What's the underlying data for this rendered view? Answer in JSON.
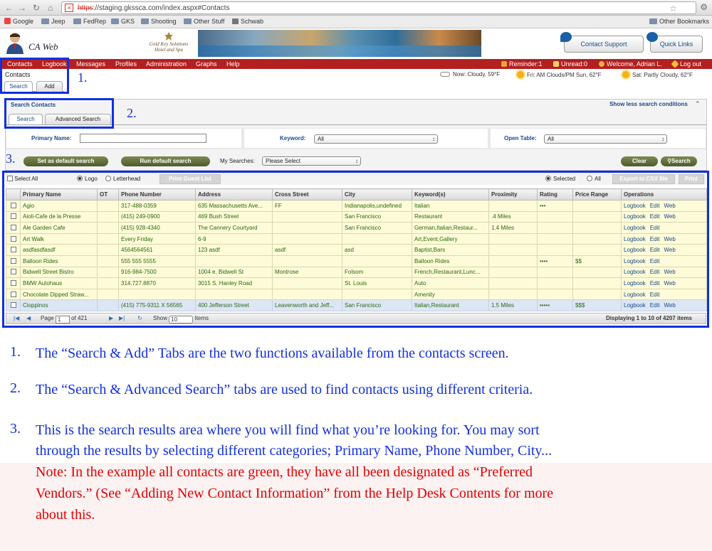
{
  "browser": {
    "url_scheme": "https",
    "url_rest": "://staging.gkssca.com/index.aspx#Contacts",
    "bookmarks": [
      "Google",
      "Jeep",
      "FedRep",
      "GKS",
      "Shooting",
      "Other Stuff",
      "Schwab"
    ],
    "other_bookmarks": "Other Bookmarks"
  },
  "header": {
    "app_name": "CA Web",
    "hotel_logo": "Gold Key Solutions Hotel and Spa",
    "contact_support": "Contact Support",
    "quick_links": "Quick Links"
  },
  "menu": {
    "items": [
      "Contacts",
      "Logbook",
      "Messages",
      "Profiles",
      "Administration",
      "Graphs",
      "Help"
    ],
    "reminder": "Reminder:1",
    "unread": "Unread:0",
    "welcome": "Welcome, Adrian L.",
    "logout": "Log out"
  },
  "sub": {
    "crumb": "Contacts",
    "tabs": [
      "Search",
      "Add"
    ]
  },
  "weather": {
    "now": "Now: Cloudy, 59°F",
    "fri": "Fri: AM Clouds/PM Sun, 62°F",
    "sat": "Sat: Partly Cloudy, 62°F"
  },
  "search": {
    "title": "Search Contacts",
    "show_less": "Show less search conditions",
    "tabs": [
      "Search",
      "Advanced Search"
    ],
    "primary_name_label": "Primary Name:",
    "primary_name_value": "",
    "keyword_label": "Keyword:",
    "keyword_value": "All",
    "open_table_label": "Open Table:",
    "open_table_value": "All",
    "set_default": "Set as default search",
    "run_default": "Run default search",
    "my_searches_label": "My Searches:",
    "my_searches_value": "Please Select",
    "clear": "Clear",
    "search_btn": "Search"
  },
  "annotations": [
    "1.",
    "2.",
    "3."
  ],
  "grid": {
    "select_all": "Select All",
    "logo": "Logo",
    "letterhead": "Letterhead",
    "print_guest_list": "Print Guest List",
    "selected": "Selected",
    "all": "All",
    "export_csv": "Export to CSV file",
    "print": "Print",
    "columns": [
      "Primary Name",
      "OT",
      "Phone Number",
      "Address",
      "Cross Street",
      "City",
      "Keyword(s)",
      "Proximity",
      "Rating",
      "Price Range",
      "Operations"
    ],
    "rows": [
      {
        "name": "Agio",
        "ot": "",
        "phone": "317-488-0359",
        "address": "635 Massachusetts Ave...",
        "cross": "FF",
        "city": "Indianapolis,undefined",
        "keywords": "Italian",
        "proximity": "",
        "rating": "•••",
        "price": "",
        "ops": [
          "Logbook",
          "Edit",
          "Web"
        ]
      },
      {
        "name": "Aioli-Cafe de la Presse",
        "ot": "",
        "phone": "(415) 249-0900",
        "address": "469 Bush Street",
        "cross": "",
        "city": "San Francisco",
        "keywords": "Restaurant",
        "proximity": ".4 Miles",
        "rating": "",
        "price": "",
        "ops": [
          "Logbook",
          "Edit",
          "Web"
        ]
      },
      {
        "name": "Ale Garden Cafe",
        "ot": "",
        "phone": "(415) 928-4340",
        "address": "The Cannery Courtyard",
        "cross": "",
        "city": "San Francisco",
        "keywords": "German,Italian,Restaur...",
        "proximity": "1.4 Miles",
        "rating": "",
        "price": "",
        "ops": [
          "Logbook",
          "Edit",
          ""
        ]
      },
      {
        "name": "Art Walk",
        "ot": "",
        "phone": "Every Friday",
        "address": "6-9",
        "cross": "",
        "city": "",
        "keywords": "Art,Event,Gallery",
        "proximity": "",
        "rating": "",
        "price": "",
        "ops": [
          "Logbook",
          "Edit",
          "Web"
        ]
      },
      {
        "name": "asdfasdfasdf",
        "ot": "",
        "phone": "4564564561",
        "address": "123 asdf",
        "cross": "asdf",
        "city": "asd",
        "keywords": "Baptist,Bars",
        "proximity": "",
        "rating": "",
        "price": "",
        "ops": [
          "Logbook",
          "Edit",
          "Web"
        ]
      },
      {
        "name": "Balloon Rides",
        "ot": "",
        "phone": "555 555 5555",
        "address": "",
        "cross": "",
        "city": "",
        "keywords": "Balloon Rides",
        "proximity": "",
        "rating": "••••",
        "price": "$$",
        "ops": [
          "Logbook",
          "Edit",
          ""
        ]
      },
      {
        "name": "Bidwell Street Bistro",
        "ot": "",
        "phone": "916-984-7500",
        "address": "1004 e. Bidwell St",
        "cross": "Montrose",
        "city": "Folsom",
        "keywords": "French,Restaurant,Lunc...",
        "proximity": "",
        "rating": "",
        "price": "",
        "ops": [
          "Logbook",
          "Edit",
          "Web"
        ]
      },
      {
        "name": "BMW Autohaus",
        "ot": "",
        "phone": "314.727.8870",
        "address": "3015 S. Hanley Road",
        "cross": "",
        "city": "St. Louis",
        "keywords": "Auto",
        "proximity": "",
        "rating": "",
        "price": "",
        "ops": [
          "Logbook",
          "Edit",
          "Web"
        ]
      },
      {
        "name": "Chocolate Dipped Straw...",
        "ot": "",
        "phone": "",
        "address": "",
        "cross": "",
        "city": "",
        "keywords": "Amenity",
        "proximity": "",
        "rating": "",
        "price": "",
        "ops": [
          "Logbook",
          "Edit",
          ""
        ]
      },
      {
        "name": "Cioppinos",
        "ot": "",
        "phone": "(415) 775-9311 X 56565",
        "address": "400 Jefferson Street",
        "cross": "Leavenworth and Jeff...",
        "city": "San Francisco",
        "keywords": "Italian,Restaurant",
        "proximity": "1.5 Miles",
        "rating": "•••••",
        "price": "$$$",
        "ops": [
          "Logbook",
          "Edit",
          "Web"
        ]
      }
    ],
    "pager": {
      "page_label": "Page",
      "page_value": "1",
      "of": "of 421",
      "show_label": "Show",
      "show_value": "10",
      "items": "Items",
      "displaying": "Displaying 1 to 10 of 4207 items"
    }
  },
  "notes": {
    "n1_num": "1.",
    "n1": "The “Search & Add” Tabs are the two functions available from the contacts screen.",
    "n2_num": "2.",
    "n2": "The “Search & Advanced Search” tabs are used to find contacts using different criteria.",
    "n3_num": "3.",
    "n3_line1": "This is the search results area where you will find what you’re looking for.  You may sort",
    "n3_line2": "through the results by selecting different categories; Primary Name, Phone Number, City...",
    "note_line1": "Note:  In the example all contacts are green, they have all been designated as “Preferred",
    "note_line2": "Vendors.”  (See “Adding New Contact Information” from the Help Desk Contents for more",
    "note_line3": "about this."
  }
}
